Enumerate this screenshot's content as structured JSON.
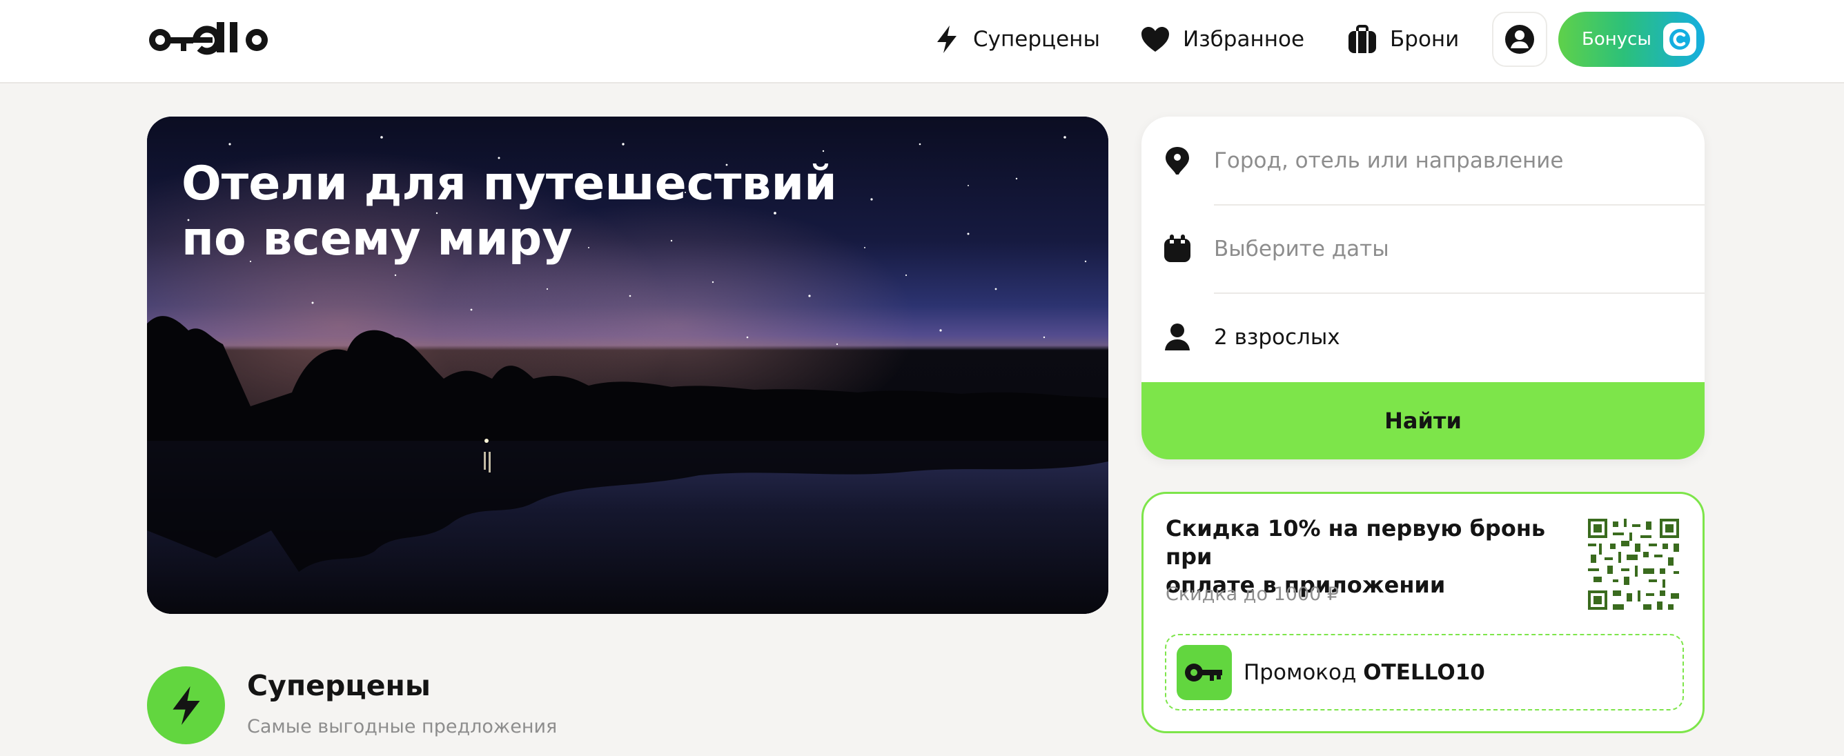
{
  "header": {
    "logo_text": "otello",
    "nav": [
      {
        "label": "Суперцены",
        "icon": "lightning-icon"
      },
      {
        "label": "Избранное",
        "icon": "heart-icon"
      },
      {
        "label": "Брони",
        "icon": "suitcase-icon"
      }
    ],
    "profile_icon": "user-icon",
    "bonus": {
      "label": "Бонусы",
      "icon": "coin-c-icon"
    }
  },
  "hero": {
    "title_line1": "Отели для путешествий",
    "title_line2": "по всему миру",
    "image": "night-sky-lake-photo"
  },
  "search": {
    "destination_placeholder": "Город, отель или направление",
    "dates_placeholder": "Выберите даты",
    "guests_value": "2 взрослых",
    "submit_label": "Найти"
  },
  "promo": {
    "title_line1": "Скидка 10% на первую бронь при",
    "title_line2": "оплате в приложении",
    "subtitle": "Скидка до 1000 ₽",
    "code_prefix": "Промокод",
    "code": "OTELLO10",
    "qr_icon": "qr-code-icon",
    "key_icon": "key-icon"
  },
  "superprices": {
    "title": "Суперцены",
    "subtitle": "Самые выгодные предложения"
  },
  "colors": {
    "accent_green": "#7de54a",
    "icon_green": "#62d63f",
    "placeholder_gray": "#8d8d8d",
    "text_dark": "#141414",
    "background": "#f5f4f2"
  }
}
